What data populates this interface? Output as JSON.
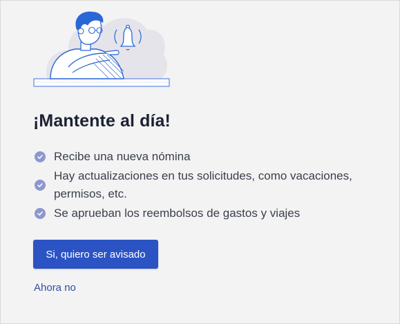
{
  "dialog": {
    "title": "¡Mantente al día!",
    "benefits": [
      {
        "text": "Recibe una nueva nómina"
      },
      {
        "text": "Hay actualizaciones en tus solicitudes, como vacaciones, permisos, etc."
      },
      {
        "text": "Se aprueban los reembolsos de gastos y viajes"
      }
    ],
    "primary_button": "Si, quiero ser avisado",
    "secondary_link": "Ahora no"
  },
  "colors": {
    "accent": "#2b53c4",
    "link": "#2e4fa3",
    "check_badge": "#8d97cf",
    "bell_clapper": "#e0493d",
    "title": "#1b2133",
    "body_text": "#3a3f4d",
    "background": "#f3f3f3"
  },
  "icons": {
    "illustration": "person-notification-bell-illustration",
    "benefit_marker": "check-circle-icon"
  }
}
